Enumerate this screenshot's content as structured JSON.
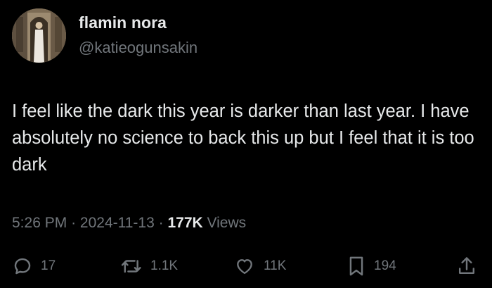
{
  "user": {
    "display_name": "flamin nora",
    "handle": "@katieogunsakin",
    "avatar_icon": "profile-photo"
  },
  "tweet": {
    "text": "I feel like the dark this year is darker than last year. I have absolutely no science to back this up but I feel that it is too dark"
  },
  "meta": {
    "time": "5:26 PM",
    "separator": "·",
    "date": "2024-11-13",
    "views_count": "177K",
    "views_label": "Views"
  },
  "actions": {
    "reply": {
      "icon": "reply-icon",
      "count": "17"
    },
    "retweet": {
      "icon": "retweet-icon",
      "count": "1.1K"
    },
    "like": {
      "icon": "heart-icon",
      "count": "11K"
    },
    "bookmark": {
      "icon": "bookmark-icon",
      "count": "194"
    },
    "share": {
      "icon": "share-icon"
    }
  },
  "colors": {
    "background": "#000000",
    "primary_text": "#e7e9ea",
    "secondary_text": "#71767b"
  }
}
